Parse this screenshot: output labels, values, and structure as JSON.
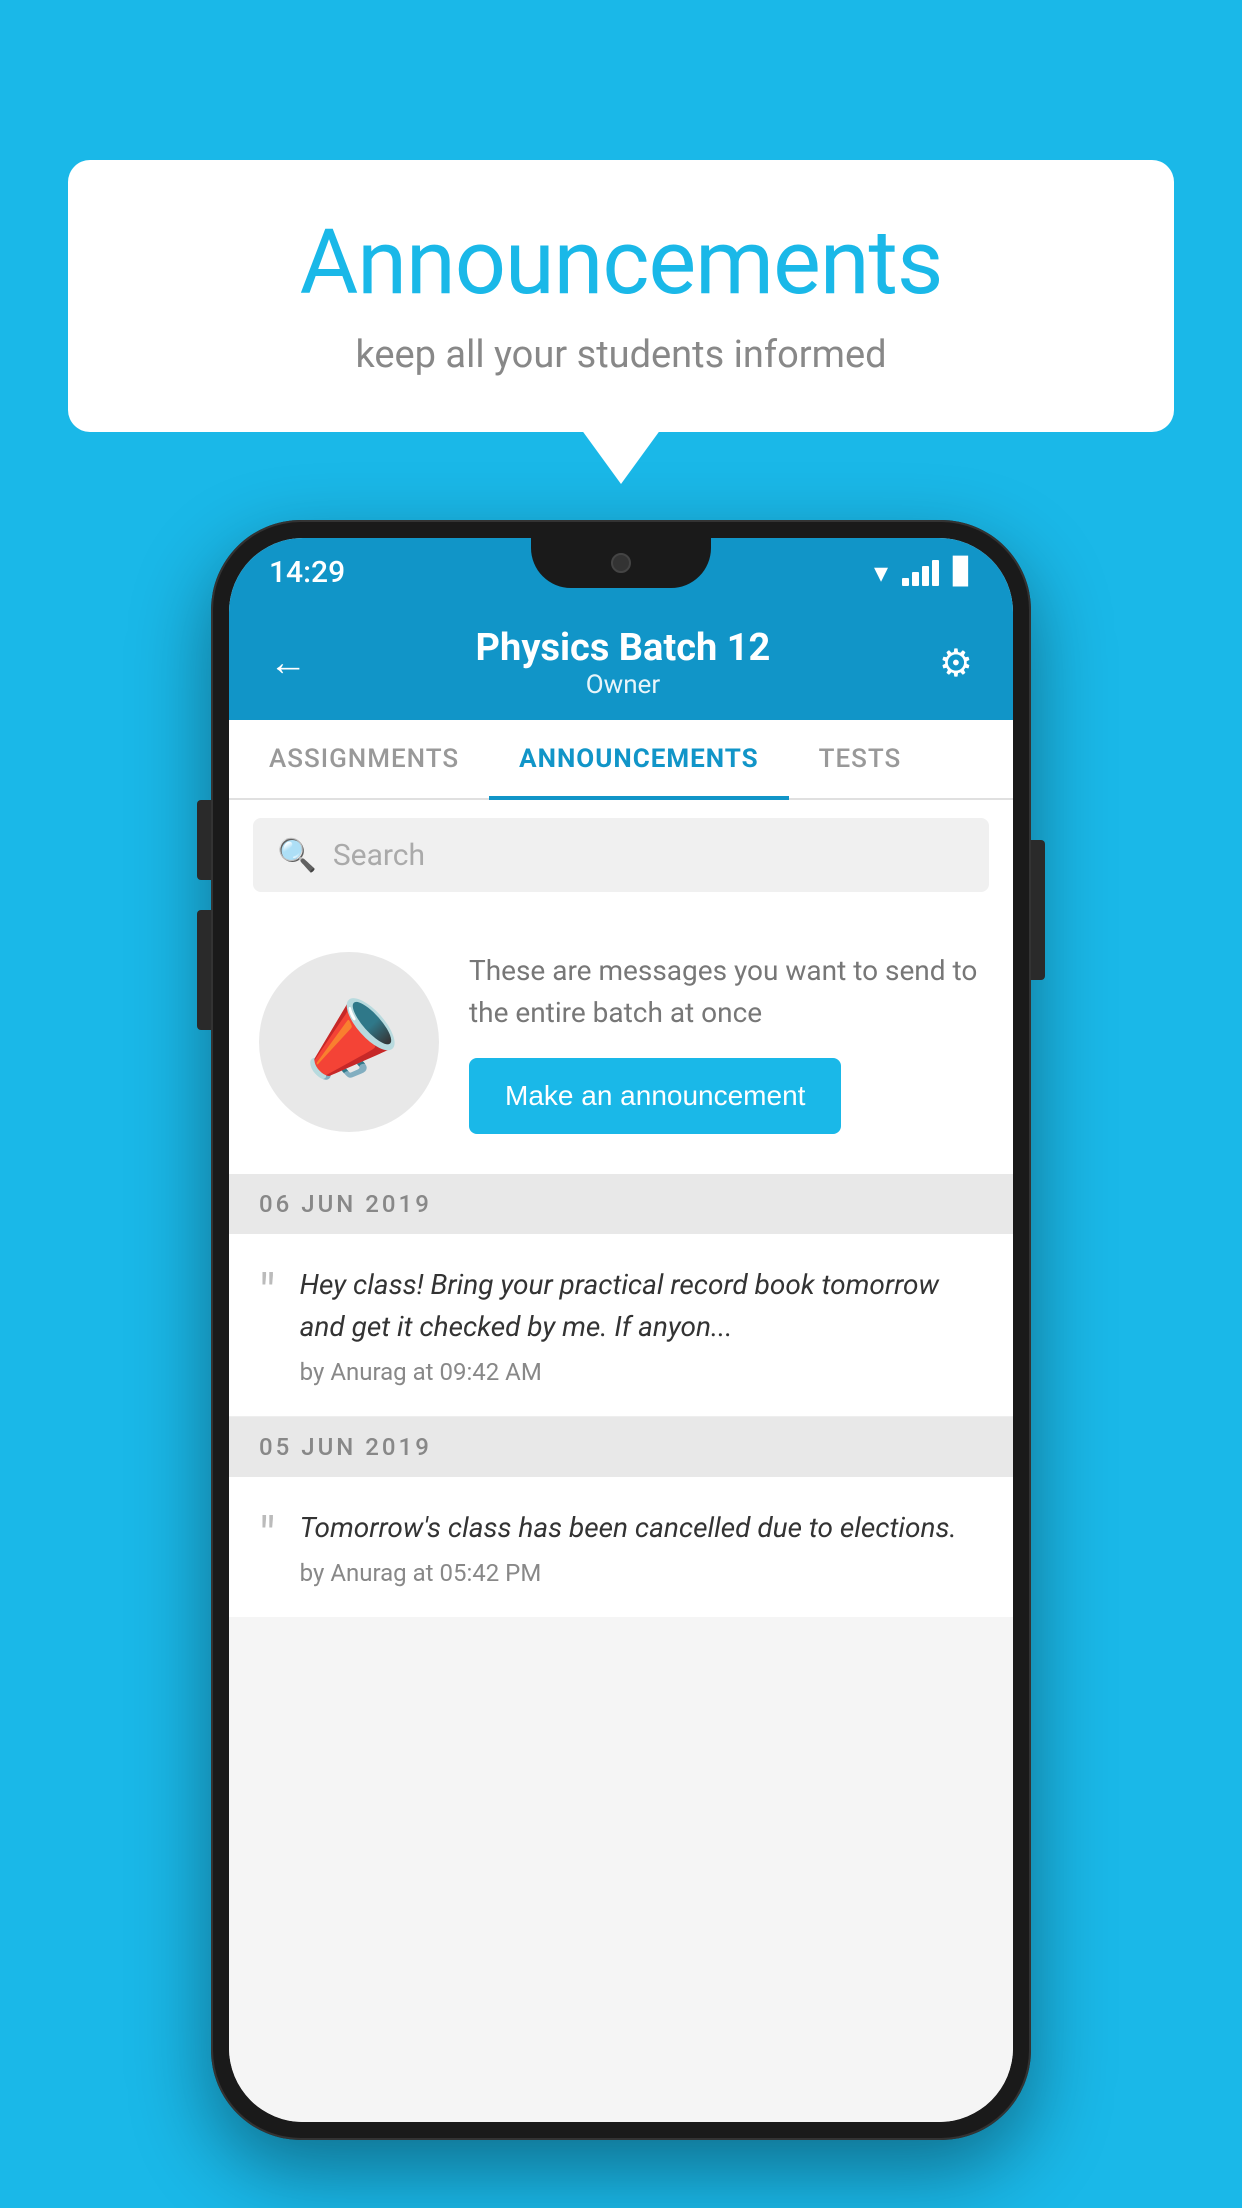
{
  "background_color": "#1ab8e8",
  "speech_bubble": {
    "title": "Announcements",
    "subtitle": "keep all your students informed"
  },
  "status_bar": {
    "time": "14:29"
  },
  "app_header": {
    "title": "Physics Batch 12",
    "subtitle": "Owner",
    "back_label": "←",
    "gear_label": "⚙"
  },
  "tabs": [
    {
      "label": "ASSIGNMENTS",
      "active": false
    },
    {
      "label": "ANNOUNCEMENTS",
      "active": true
    },
    {
      "label": "TESTS",
      "active": false
    }
  ],
  "search": {
    "placeholder": "Search"
  },
  "promo": {
    "description": "These are messages you want to send to the entire batch at once",
    "button_label": "Make an announcement"
  },
  "announcements": [
    {
      "date": "06  JUN  2019",
      "text": "Hey class! Bring your practical record book tomorrow and get it checked by me. If anyon...",
      "meta": "by Anurag at 09:42 AM"
    },
    {
      "date": "05  JUN  2019",
      "text": "Tomorrow's class has been cancelled due to elections.",
      "meta": "by Anurag at 05:42 PM"
    }
  ]
}
